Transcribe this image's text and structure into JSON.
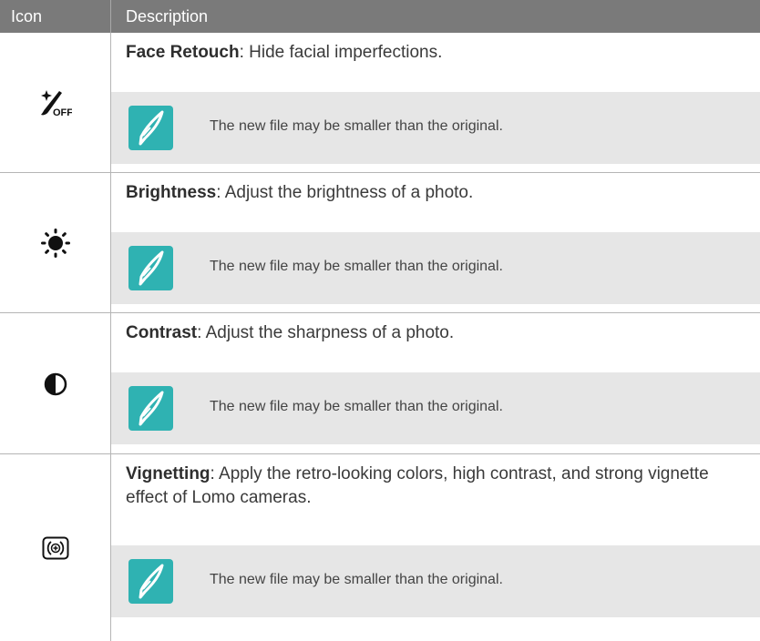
{
  "header": {
    "icon_col": "Icon",
    "desc_col": "Description"
  },
  "rows": [
    {
      "icon": "face-retouch-off-icon",
      "title": "Face Retouch",
      "text": ": Hide facial imperfections.",
      "note": "The new file may be smaller than the original."
    },
    {
      "icon": "brightness-icon",
      "title": "Brightness",
      "text": ": Adjust the brightness of a photo.",
      "note": "The new file may be smaller than the original."
    },
    {
      "icon": "contrast-icon",
      "title": "Contrast",
      "text": ": Adjust the sharpness of a photo.",
      "note": "The new file may be smaller than the original."
    },
    {
      "icon": "vignetting-icon",
      "title": "Vignetting",
      "text": ": Apply the retro-looking colors, high contrast, and strong vignette effect of Lomo cameras.",
      "note": "The new file may be smaller than the original."
    }
  ],
  "colors": {
    "header_bg": "#7a7a7a",
    "note_bg": "#e6e6e6",
    "note_icon": "#2fb2b2"
  }
}
